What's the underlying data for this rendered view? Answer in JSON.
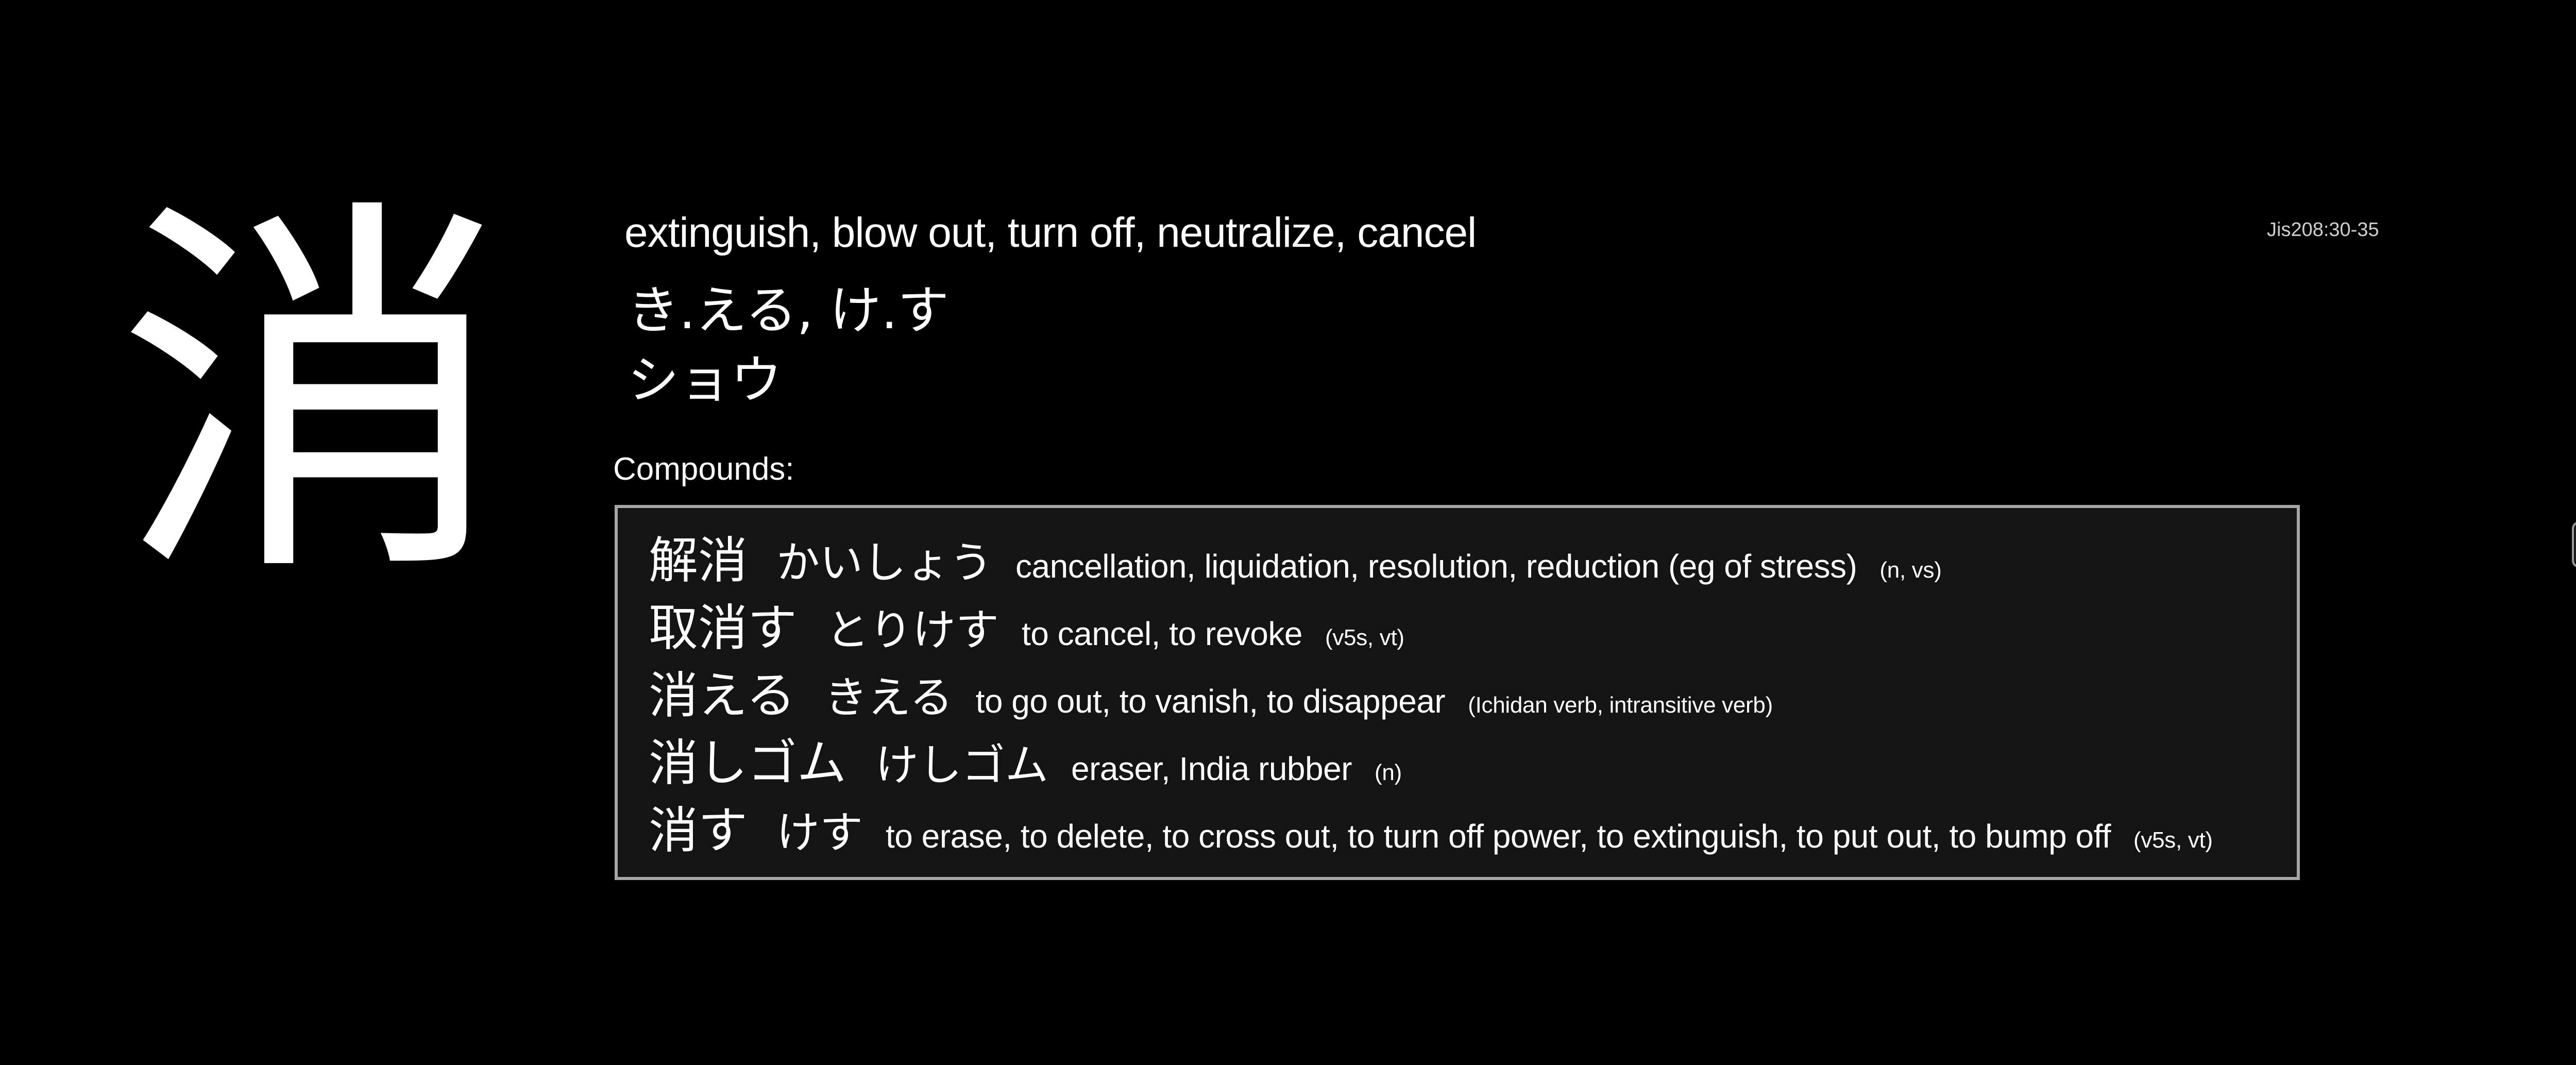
{
  "kanji": {
    "character": "消",
    "meanings": "extinguish, blow out, turn off, neutralize, cancel",
    "kun_readings": "き.える, け.す",
    "on_readings": "ショウ",
    "jis_code": "Jis208:30-35"
  },
  "compounds": {
    "label": "Compounds:",
    "items": [
      {
        "word": "解消",
        "reading": "かいしょう",
        "gloss": "cancellation, liquidation, resolution, reduction (eg of stress)",
        "pos": "(n, vs)"
      },
      {
        "word": "取消す",
        "reading": "とりけす",
        "gloss": "to cancel, to revoke",
        "pos": "(v5s, vt)"
      },
      {
        "word": "消える",
        "reading": "きえる",
        "gloss": "to go out, to vanish, to disappear",
        "pos": "(Ichidan verb, intransitive verb)"
      },
      {
        "word": "消しゴム",
        "reading": "けしゴム",
        "gloss": "eraser, India rubber",
        "pos": "(n)"
      },
      {
        "word": "消す",
        "reading": "けす",
        "gloss": "to erase, to delete, to cross out, to turn off power, to extinguish, to put out, to bump off",
        "pos": "(v5s, vt)"
      }
    ]
  },
  "colors": {
    "background": "#000000",
    "text": "#ffffff",
    "box_background": "#141414",
    "box_border": "#a6a6a6"
  }
}
